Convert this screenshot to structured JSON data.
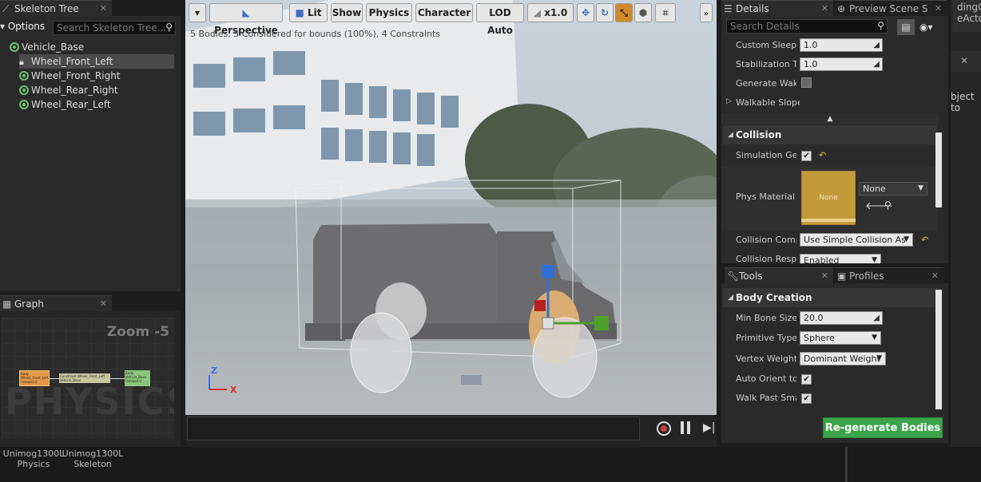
{
  "skeleton_tree": {
    "tab_label": "Skeleton Tree",
    "options_label": "Options",
    "search_placeholder": "Search Skeleton Tree...",
    "items": [
      {
        "label": "Vehicle_Base"
      },
      {
        "label": "Wheel_Front_Left"
      },
      {
        "label": "Wheel_Front_Right"
      },
      {
        "label": "Wheel_Rear_Right"
      },
      {
        "label": "Wheel_Rear_Left"
      }
    ]
  },
  "graph": {
    "tab_label": "Graph",
    "zoom_label": "Zoom -5",
    "watermark": "PHYSICS",
    "nodes": [
      {
        "text": "Body\nWheel_Front_Left\nUshape[s]"
      },
      {
        "text": "Constraint\nWheel_Front_Left : Vehicle_Base"
      },
      {
        "text": "Body\nVehicle_Base\nUshape[s]"
      }
    ]
  },
  "viewport": {
    "perspective_label": "Perspective",
    "lit_label": "Lit",
    "show_label": "Show",
    "physics_label": "Physics",
    "character_label": "Character",
    "lod_label": "LOD Auto",
    "speed_label": "x1.0",
    "stats_text": "5 Bodies, 5 Considered for bounds (100%), 4 Constraints",
    "axis_x": "X",
    "axis_z": "Z"
  },
  "details": {
    "tab_label": "Details",
    "preview_tab_label": "Preview Scene S",
    "search_placeholder": "Search Details",
    "props": {
      "custom_sleep_label": "Custom Sleep Threshold Multiplier",
      "custom_sleep_value": "1.0",
      "stabilization_label": "Stabilization Threshold Multiplier",
      "stabilization_value": "1.0",
      "generate_wake_label": "Generate Wake Events",
      "walkable_slope_label": "Walkable Slope Override"
    },
    "collision_section": "Collision",
    "collision": {
      "sim_gen_label": "Simulation Generates Hit Events",
      "phys_material_label": "Phys Material Override",
      "phys_material_thumb": "None",
      "phys_material_value": "None",
      "collision_comp_label": "Collision Complexity",
      "collision_comp_value": "Use Simple Collision As",
      "collision_resp_label": "Collision Response",
      "collision_resp_value": "Enabled"
    }
  },
  "tools": {
    "tab_label": "Tools",
    "profiles_tab_label": "Profiles",
    "section": "Body Creation",
    "min_bone_label": "Min Bone Size",
    "min_bone_value": "20.0",
    "primitive_label": "Primitive Type",
    "primitive_value": "Sphere",
    "vertex_label": "Vertex Weighting Type",
    "vertex_value": "Dominant Weight",
    "auto_orient_label": "Auto Orient to Bone",
    "walk_past_label": "Walk Past Small Bones",
    "regen_label": "Re-generate Bodies"
  },
  "background": {
    "tab_text": "dingC",
    "tab_text2": "eActo",
    "obj_text": "bject to"
  },
  "footer": {
    "asset1": "Unimog1300L\nPhysics",
    "asset2": "Unimog1300L\nSkeleton"
  }
}
